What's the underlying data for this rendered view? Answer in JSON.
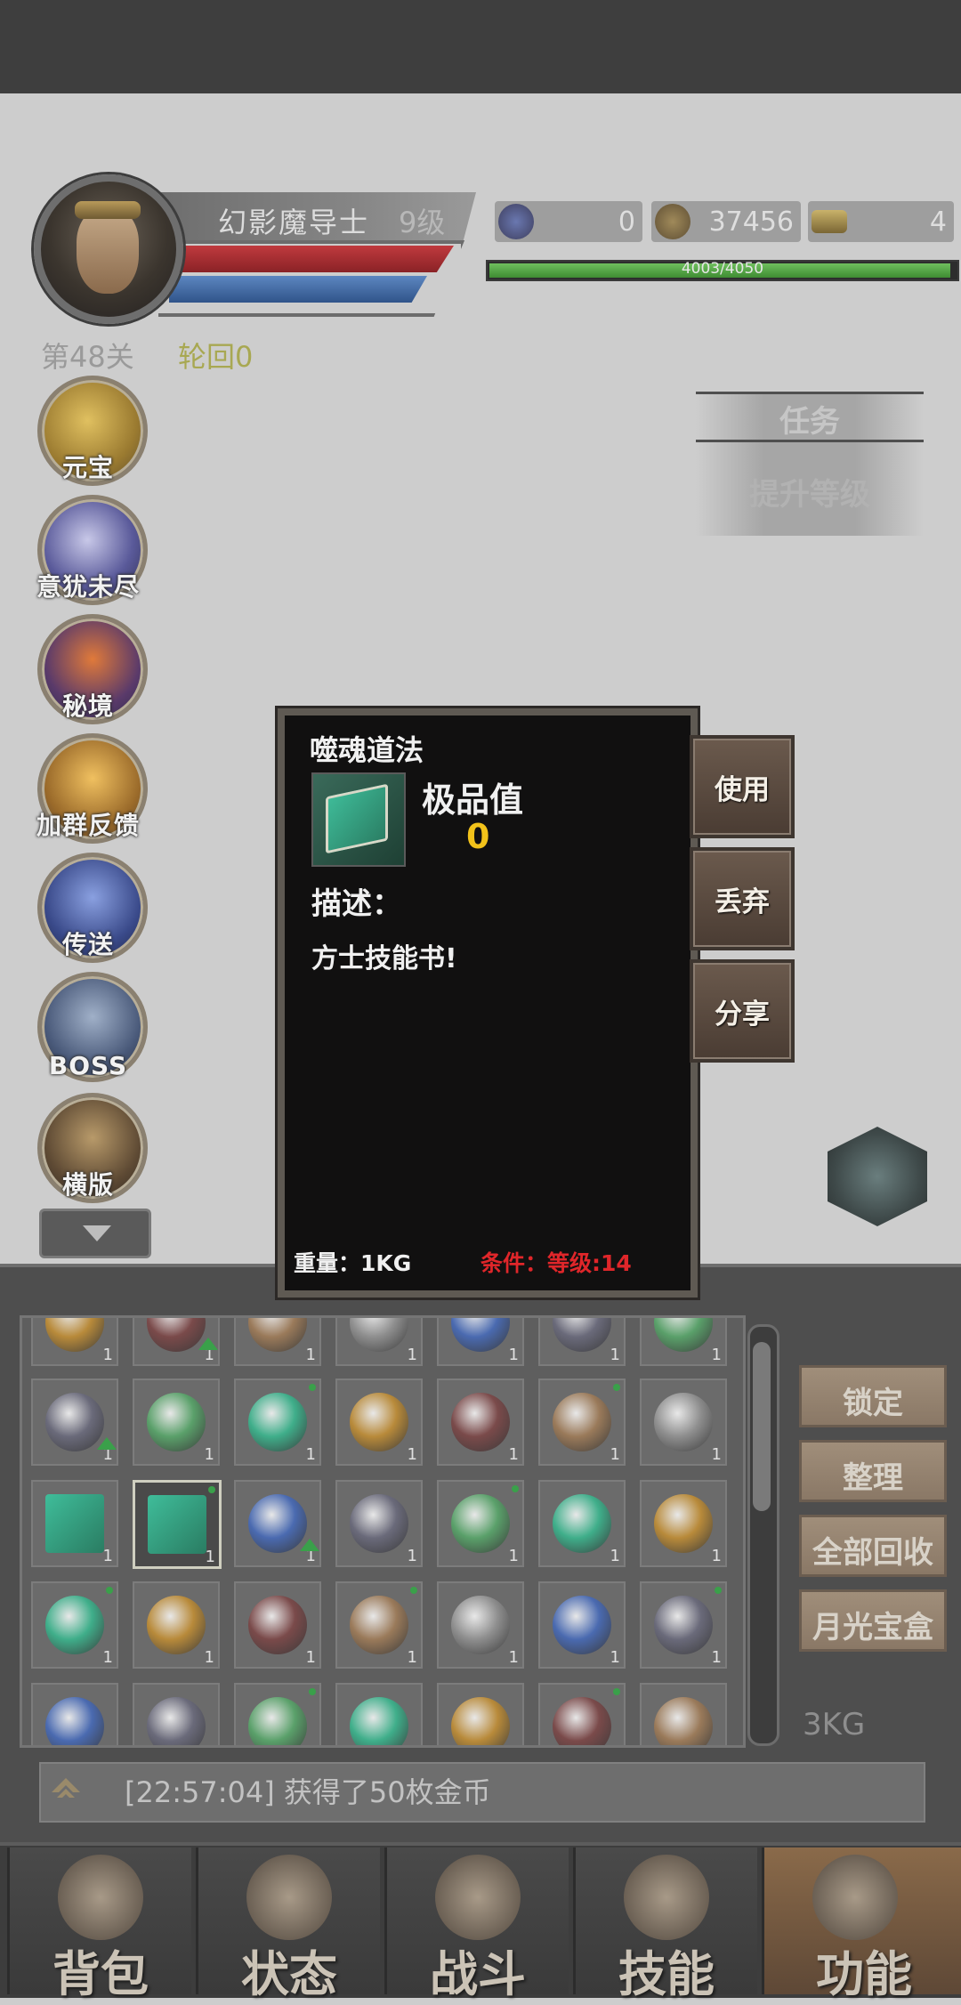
{
  "player": {
    "name": "幻影魔导士",
    "level": "9级"
  },
  "currencies": [
    {
      "icon": "compass-star-icon",
      "value": "0"
    },
    {
      "icon": "coin-bag-icon",
      "value": "37456"
    },
    {
      "icon": "gold-ingot-icon",
      "value": "4"
    }
  ],
  "xp": {
    "text": "4003/4050",
    "current": 4003,
    "max": 4050
  },
  "stage": {
    "level": "第48关",
    "cycle": "轮回0"
  },
  "side_menu": [
    "元宝",
    "意犹未尽",
    "秘境",
    "加群反馈",
    "传送",
    "BOSS",
    "横版"
  ],
  "quest": {
    "title": "任务",
    "subtitle": "提升等级"
  },
  "tooltip": {
    "item_name": "噬魂道法",
    "grade_label": "极品值",
    "grade_value": "0",
    "desc_label": "描述：",
    "desc_text": "方士技能书!",
    "weight": "重量：1KG",
    "condition": "条件：等级:14",
    "actions": [
      "使用",
      "丢弃",
      "分享"
    ]
  },
  "inventory": {
    "count_label": "1",
    "weight": "3KG",
    "buttons": [
      "锁定",
      "整理",
      "全部回收",
      "月光宝盒"
    ]
  },
  "log": {
    "text": "[22:57:04] 获得了50枚金币"
  },
  "nav": [
    "背包",
    "状态",
    "战斗",
    "技能",
    "功能"
  ],
  "colors": {
    "hp": "#c03a3e",
    "mp": "#5c86c0",
    "xp": "#4ea63f",
    "condition": "#e0262a",
    "grade": "#f2c21a"
  }
}
